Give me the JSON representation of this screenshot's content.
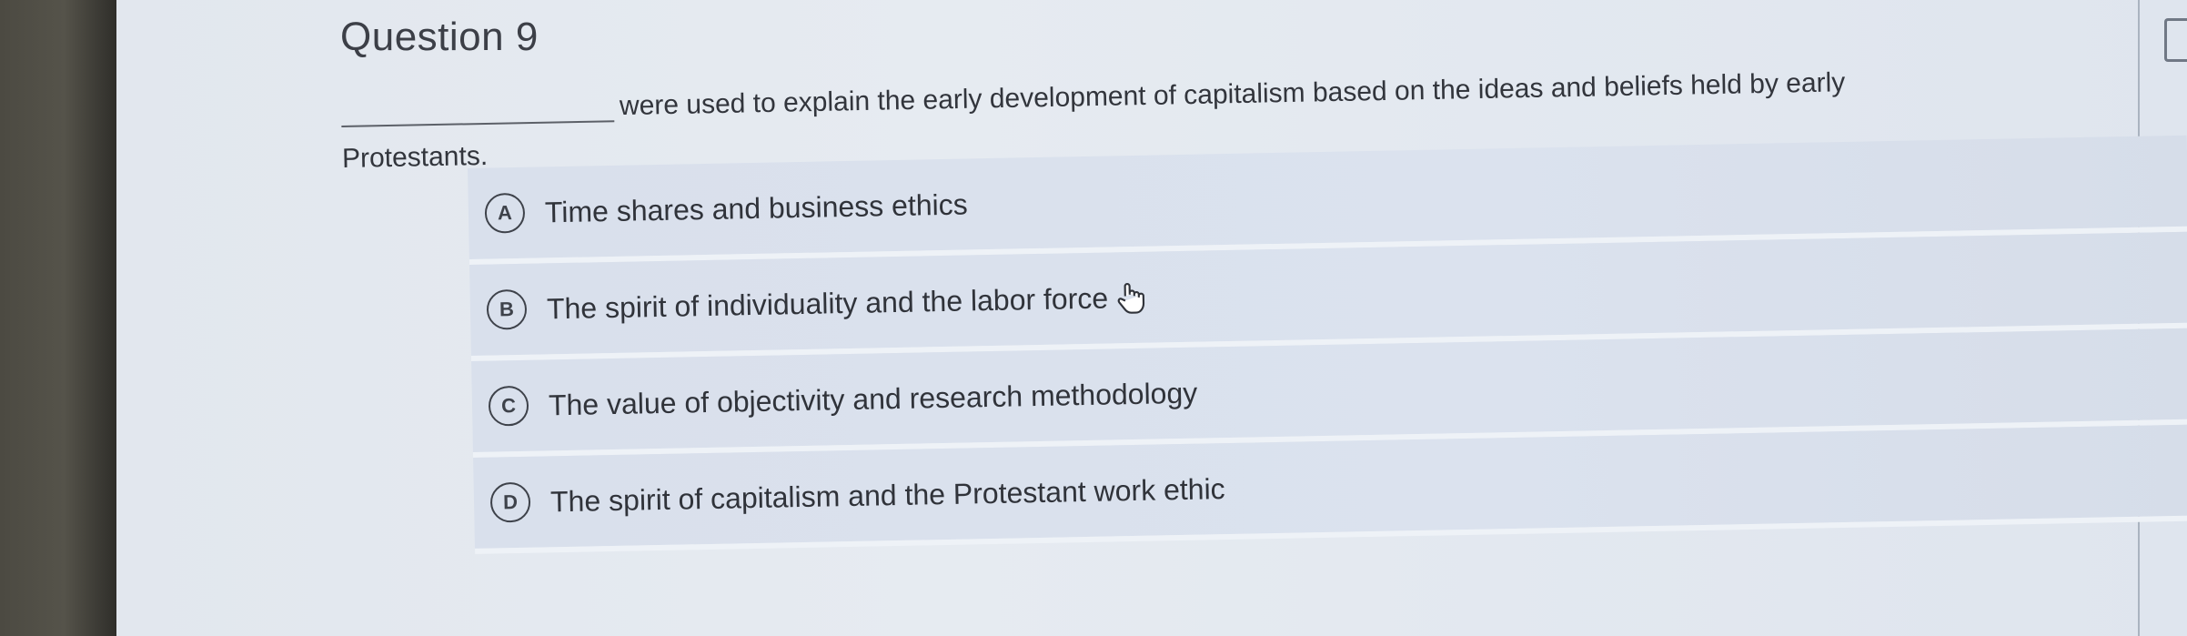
{
  "question": {
    "title": "Question 9",
    "stem_after_blank": "were used to explain the early development of capitalism based on the ideas and beliefs held by early",
    "stem_line2": "Protestants."
  },
  "options": [
    {
      "letter": "A",
      "text": "Time shares and business ethics"
    },
    {
      "letter": "B",
      "text": "The spirit of individuality and the labor force"
    },
    {
      "letter": "C",
      "text": "The value of objectivity and research methodology"
    },
    {
      "letter": "D",
      "text": "The spirit of capitalism and the Protestant work ethic"
    }
  ],
  "icons": {
    "cursor": "hand-pointer-icon"
  },
  "colors": {
    "option_bg": "#d9e0ec",
    "page_bg": "#e4e9ef",
    "text": "#32353c"
  }
}
